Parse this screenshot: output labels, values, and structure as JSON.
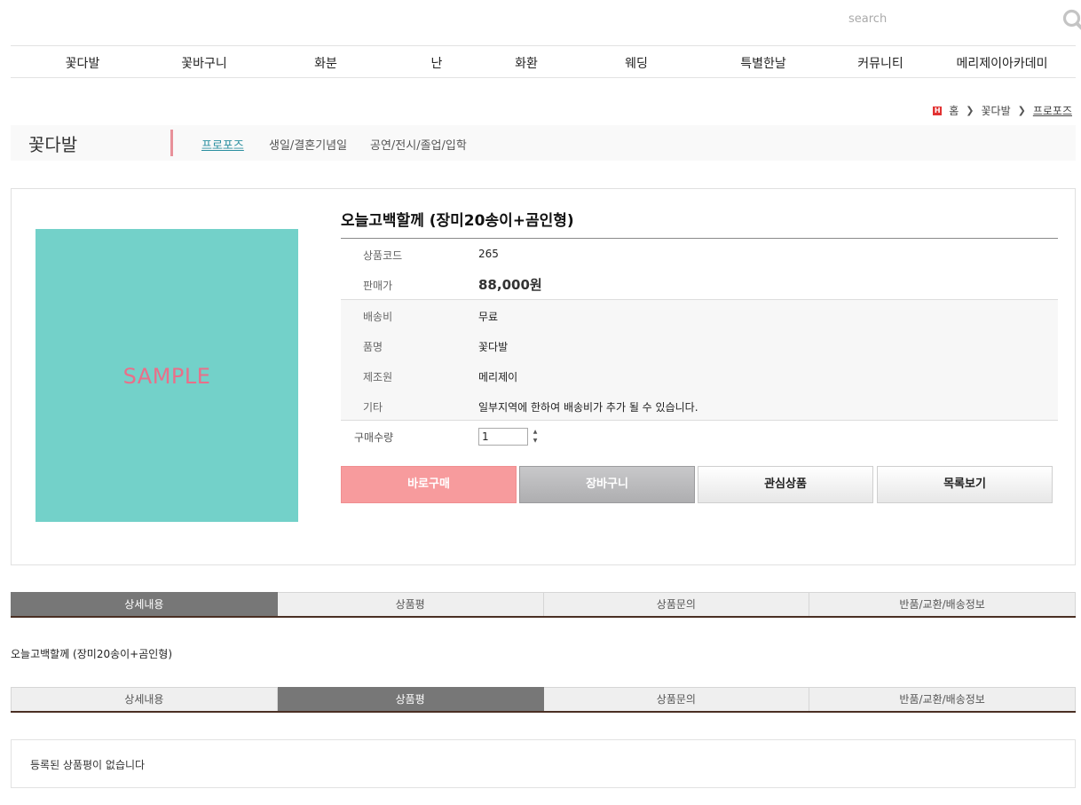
{
  "search": {
    "placeholder": "search",
    "icon": "search-icon"
  },
  "nav": {
    "items": [
      "꽃다발",
      "꽃바구니",
      "화분",
      "난",
      "화환",
      "웨딩",
      "특별한날",
      "커뮤니티",
      "메리제이아카데미"
    ]
  },
  "breadcrumb": {
    "home_icon_label": "H",
    "home": "홈",
    "level1": "꽃다발",
    "current": "프로포즈"
  },
  "category": {
    "title": "꽃다발",
    "subcategories": [
      "프로포즈",
      "생일/결혼기념일",
      "공연/전시/졸업/입학"
    ],
    "active": "프로포즈",
    "accent_color": "#e8919a"
  },
  "product": {
    "image_text": "SAMPLE",
    "image_color": "#73d1c9",
    "title": "오늘고백할께 (장미20송이+곰인형)",
    "code_label": "상품코드",
    "code": "265",
    "price_label": "판매가",
    "price": "88,000원",
    "shipping_label": "배송비",
    "shipping": "무료",
    "name_label": "품명",
    "name": "꽃다발",
    "maker_label": "제조원",
    "maker": "메리제이",
    "etc_label": "기타",
    "etc": "일부지역에 한하여 배송비가 추가 될 수 있습니다.",
    "qty_label": "구매수량",
    "qty": "1"
  },
  "buttons": {
    "buy": "바로구매",
    "cart": "장바구니",
    "wish": "관심상품",
    "list": "목록보기"
  },
  "tabs1": {
    "items": [
      "상세내용",
      "상품평",
      "상품문의",
      "반품/교환/배송정보"
    ],
    "active": "상세내용"
  },
  "detail": {
    "text": "오늘고백할께 (장미20송이+곰인형)"
  },
  "tabs2": {
    "items": [
      "상세내용",
      "상품평",
      "상품문의",
      "반품/교환/배송정보"
    ],
    "active": "상품평"
  },
  "review": {
    "empty_text": "등록된 상품평이 없습니다"
  }
}
